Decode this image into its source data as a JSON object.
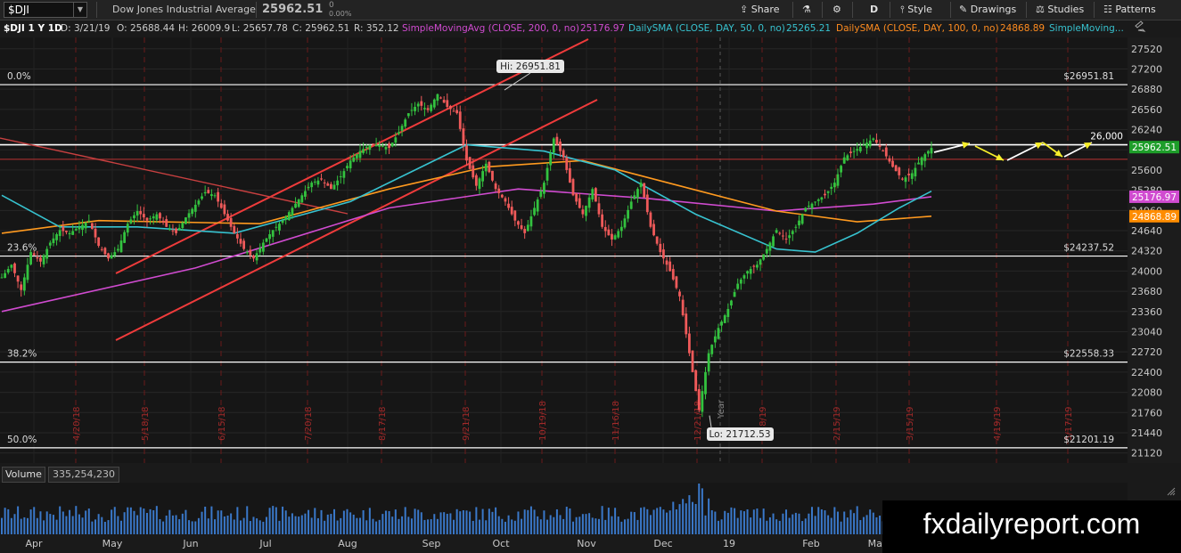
{
  "toolbar": {
    "symbol": "$DJI",
    "description": "Dow Jones Industrial Average",
    "last": "25962.51",
    "change": "0",
    "change_pct": "0.00%",
    "share": "Share",
    "period": "D",
    "style": "Style",
    "drawings": "Drawings",
    "studies": "Studies",
    "patterns": "Patterns"
  },
  "info": {
    "title": "$DJI 1 Y 1D",
    "date": "D: 3/21/19",
    "open": "O: 25688.44",
    "high": "H: 26009.9",
    "low": "L: 25657.78",
    "close": "C: 25962.51",
    "range": "R: 352.12",
    "sma200_label": "SimpleMovingAvg (CLOSE, 200, 0, no)",
    "sma200_val": "25176.97",
    "sma50_label": "DailySMA (CLOSE, DAY, 50, 0, no)",
    "sma50_val": "25265.21",
    "sma100_label": "DailySMA (CLOSE, DAY, 100, 0, no)",
    "sma100_val": "24868.89",
    "extra_label": "SimpleMoving..."
  },
  "chart_data": {
    "type": "line",
    "y_ticks": [
      27520,
      27200,
      26880,
      26560,
      26240,
      25920,
      25600,
      25280,
      24960,
      24640,
      24320,
      24000,
      23680,
      23360,
      23040,
      22720,
      22400,
      22080,
      21760,
      21440,
      21120
    ],
    "ylim": [
      20960,
      27700
    ],
    "x_labels": [
      "Apr",
      "May",
      "Jun",
      "Jul",
      "Aug",
      "Sep",
      "Oct",
      "Nov",
      "Dec",
      "19",
      "Feb",
      "Mar"
    ],
    "expiry_labels": [
      "4/20/18",
      "5/18/18",
      "6/15/18",
      "7/20/18",
      "8/17/18",
      "9/21/18",
      "10/19/18",
      "11/16/18",
      "12/21/18",
      "1/18/19",
      "2/15/19",
      "3/15/19",
      "4/19/19",
      "5/17/19"
    ],
    "year_label": "Year",
    "price_series": [
      [
        0,
        23900
      ],
      [
        3,
        24100
      ],
      [
        6,
        23700
      ],
      [
        9,
        24300
      ],
      [
        12,
        24150
      ],
      [
        15,
        24450
      ],
      [
        18,
        24650
      ],
      [
        21,
        24600
      ],
      [
        24,
        24700
      ],
      [
        27,
        24800
      ],
      [
        30,
        24400
      ],
      [
        33,
        24200
      ],
      [
        36,
        24350
      ],
      [
        39,
        24750
      ],
      [
        42,
        24950
      ],
      [
        45,
        24800
      ],
      [
        48,
        24900
      ],
      [
        51,
        24700
      ],
      [
        54,
        24600
      ],
      [
        57,
        24850
      ],
      [
        60,
        25050
      ],
      [
        63,
        25250
      ],
      [
        66,
        25200
      ],
      [
        69,
        24900
      ],
      [
        72,
        24600
      ],
      [
        75,
        24350
      ],
      [
        78,
        24200
      ],
      [
        81,
        24450
      ],
      [
        84,
        24650
      ],
      [
        87,
        24800
      ],
      [
        90,
        25000
      ],
      [
        93,
        25200
      ],
      [
        96,
        25400
      ],
      [
        99,
        25450
      ],
      [
        102,
        25300
      ],
      [
        105,
        25500
      ],
      [
        108,
        25750
      ],
      [
        111,
        25900
      ],
      [
        114,
        26000
      ],
      [
        117,
        26000
      ],
      [
        120,
        25950
      ],
      [
        123,
        26200
      ],
      [
        126,
        26500
      ],
      [
        129,
        26650
      ],
      [
        132,
        26550
      ],
      [
        135,
        26800
      ],
      [
        138,
        26600
      ],
      [
        141,
        26500
      ],
      [
        144,
        25750
      ],
      [
        147,
        25350
      ],
      [
        150,
        25700
      ],
      [
        153,
        25300
      ],
      [
        156,
        25100
      ],
      [
        159,
        24800
      ],
      [
        162,
        24600
      ],
      [
        165,
        25000
      ],
      [
        168,
        25400
      ],
      [
        171,
        26100
      ],
      [
        174,
        25800
      ],
      [
        177,
        25200
      ],
      [
        180,
        24900
      ],
      [
        183,
        25300
      ],
      [
        186,
        24700
      ],
      [
        189,
        24500
      ],
      [
        192,
        24700
      ],
      [
        195,
        25100
      ],
      [
        198,
        25400
      ],
      [
        201,
        24700
      ],
      [
        204,
        24300
      ],
      [
        207,
        24000
      ],
      [
        210,
        23600
      ],
      [
        213,
        22700
      ],
      [
        216,
        21800
      ],
      [
        219,
        22700
      ],
      [
        222,
        23100
      ],
      [
        225,
        23400
      ],
      [
        228,
        23800
      ],
      [
        231,
        24000
      ],
      [
        234,
        24100
      ],
      [
        237,
        24350
      ],
      [
        240,
        24650
      ],
      [
        243,
        24500
      ],
      [
        246,
        24700
      ],
      [
        249,
        25000
      ],
      [
        252,
        25100
      ],
      [
        255,
        25200
      ],
      [
        258,
        25400
      ],
      [
        261,
        25800
      ],
      [
        264,
        25900
      ],
      [
        267,
        26000
      ],
      [
        270,
        26100
      ],
      [
        273,
        25900
      ],
      [
        276,
        25650
      ],
      [
        279,
        25450
      ],
      [
        282,
        25550
      ],
      [
        285,
        25800
      ],
      [
        288,
        25950
      ]
    ],
    "sma200": [
      [
        0,
        23360
      ],
      [
        60,
        24050
      ],
      [
        120,
        25000
      ],
      [
        160,
        25300
      ],
      [
        200,
        25150
      ],
      [
        240,
        24950
      ],
      [
        270,
        25060
      ],
      [
        288,
        25177
      ]
    ],
    "sma50": [
      [
        0,
        25200
      ],
      [
        18,
        24700
      ],
      [
        42,
        24700
      ],
      [
        72,
        24600
      ],
      [
        108,
        25100
      ],
      [
        144,
        26000
      ],
      [
        168,
        25900
      ],
      [
        190,
        25600
      ],
      [
        215,
        24900
      ],
      [
        240,
        24350
      ],
      [
        252,
        24300
      ],
      [
        265,
        24600
      ],
      [
        278,
        25000
      ],
      [
        288,
        25265
      ]
    ],
    "sma100": [
      [
        0,
        24600
      ],
      [
        30,
        24800
      ],
      [
        80,
        24750
      ],
      [
        120,
        25300
      ],
      [
        150,
        25650
      ],
      [
        180,
        25750
      ],
      [
        210,
        25350
      ],
      [
        240,
        24950
      ],
      [
        265,
        24780
      ],
      [
        288,
        24869
      ]
    ],
    "fib_levels": [
      {
        "pct": "0.0%",
        "value": 26951.81,
        "label": "$26951.81"
      },
      {
        "pct": "23.6%",
        "value": 24237.52,
        "label": "$24237.52"
      },
      {
        "pct": "38.2%",
        "value": 22558.33,
        "label": "$22558.33"
      },
      {
        "pct": "50.0%",
        "value": 21201.19,
        "label": "$21201.19"
      }
    ],
    "resistance": {
      "value": 26000,
      "label": "26,000"
    },
    "hi_label": "Hi: 26951.81",
    "lo_label": "Lo: 21712.53",
    "price_tags": [
      {
        "value": 25962.51,
        "label": "25962.51",
        "color": "#1e9e2a"
      },
      {
        "value": 25176.97,
        "label": "25176.97",
        "color": "#d04bd0"
      },
      {
        "value": 24868.89,
        "label": "24868.89",
        "color": "#ff8c00"
      }
    ],
    "volume_label": "Volume",
    "volume_value": "335,254,230",
    "colors": {
      "up": "#33c23f",
      "down": "#ef5a5a",
      "sma200": "#d04bd0",
      "sma50": "#37c2cf",
      "sma100": "#ff9a1f",
      "channel": "#ef3b3b",
      "fib": "#ffffff",
      "arrows": "#f7ee2b"
    }
  },
  "watermark": "fxdailyreport.com"
}
